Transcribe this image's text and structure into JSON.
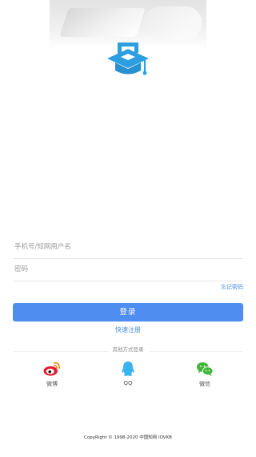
{
  "login_form": {
    "phone_placeholder": "手机号/知网用户名",
    "password_placeholder": "密码",
    "forgot_label": "忘记密码",
    "login_label": "登录",
    "register_label": "快速注册"
  },
  "other_login": {
    "label": "其他方式登录",
    "items": [
      {
        "label": "微博",
        "icon": "weibo-icon",
        "color": "#e6162d"
      },
      {
        "label": "QQ",
        "icon": "qq-icon",
        "color": "#39b4f0"
      },
      {
        "label": "微信",
        "icon": "wechat-icon",
        "color": "#3fb837"
      }
    ]
  },
  "footer": {
    "copyright": "CopyRight © 1998-2020 中国知网  IOVKB"
  },
  "colors": {
    "primary": "#4f8ef0",
    "link": "#4a8be0",
    "logo": "#2d9ee0"
  }
}
